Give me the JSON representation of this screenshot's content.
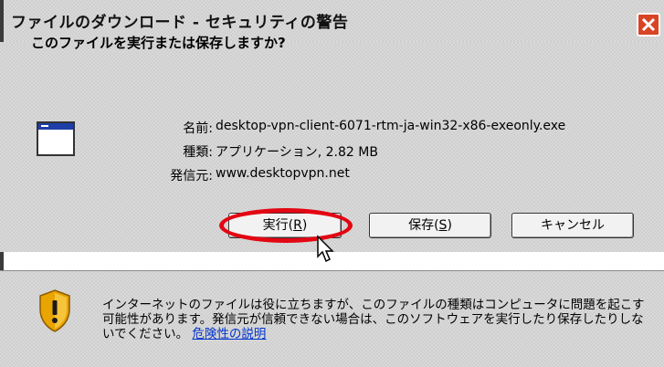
{
  "window": {
    "title": "ファイルのダウンロード - セキュリティの警告"
  },
  "dialog": {
    "question": "このファイルを実行または保存しますか?",
    "file": {
      "name_label": "名前:",
      "name_value": "desktop-vpn-client-6071-rtm-ja-win32-x86-exeonly.exe",
      "type_label": "種類:",
      "type_value": "アプリケーション, 2.82 MB",
      "source_label": "発信元:",
      "source_value": "www.desktopvpn.net"
    },
    "buttons": {
      "run_label": "実行(",
      "run_key": "R",
      "save_label": "保存(",
      "save_key": "S",
      "cancel_label": "キャンセル"
    },
    "warning": {
      "text": "インターネットのファイルは役に立ちますが、このファイルの種類はコンピュータに問題を起こす可能性があります。発信元が信頼できない場合は、このソフトウェアを実行したり保存したりしないでください。",
      "link": "危険性の説明"
    }
  },
  "colors": {
    "highlight": "#e30613",
    "link": "#0033cc",
    "title_close": "#d84525"
  }
}
